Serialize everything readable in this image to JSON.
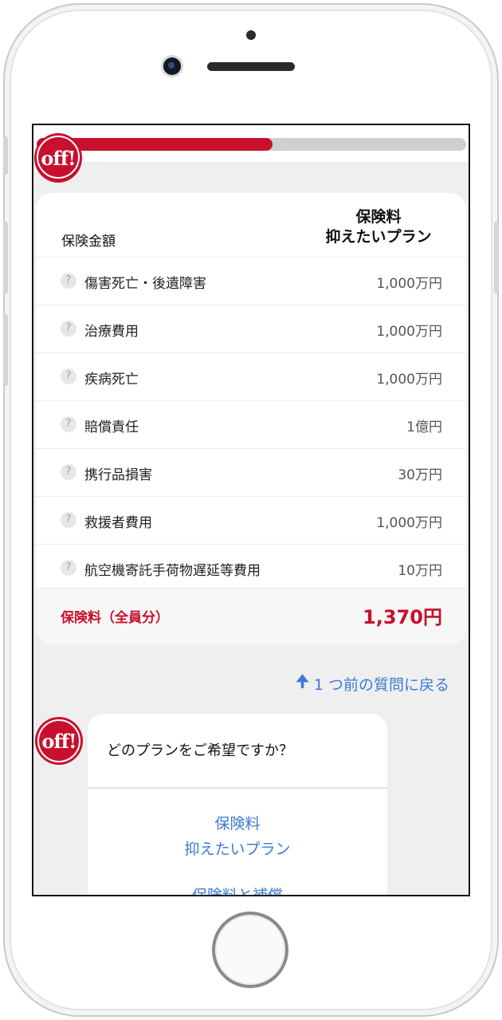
{
  "progress": {
    "fraction": 0.55
  },
  "brand": {
    "logo_text": "off!",
    "accent": "#c8102e",
    "link_color": "#3a7bd5"
  },
  "table": {
    "column_label": "保険金額",
    "plan_name_line1": "保険料",
    "plan_name_line2": "抑えたいプラン",
    "help_icon_glyph": "?",
    "rows": [
      {
        "name": "傷害死亡・後遺障害",
        "value": "1,000万円"
      },
      {
        "name": "治療費用",
        "value": "1,000万円"
      },
      {
        "name": "疾病死亡",
        "value": "1,000万円"
      },
      {
        "name": "賠償責任",
        "value": "1億円"
      },
      {
        "name": "携行品損害",
        "value": "30万円"
      },
      {
        "name": "救援者費用",
        "value": "1,000万円"
      },
      {
        "name": "航空機寄託手荷物遅延等費用",
        "value": "10万円"
      }
    ],
    "total_label": "保険料（全員分）",
    "total_value": "1,370円"
  },
  "back_link": {
    "arrow_icon": "up-arrow-icon",
    "label": "1 つ前の質問に戻る"
  },
  "chat": {
    "question": "どのプランをご希望ですか？",
    "option1_line1": "保険料",
    "option1_line2": "抑えたいプラン",
    "option2_label": "保険料と補償"
  }
}
